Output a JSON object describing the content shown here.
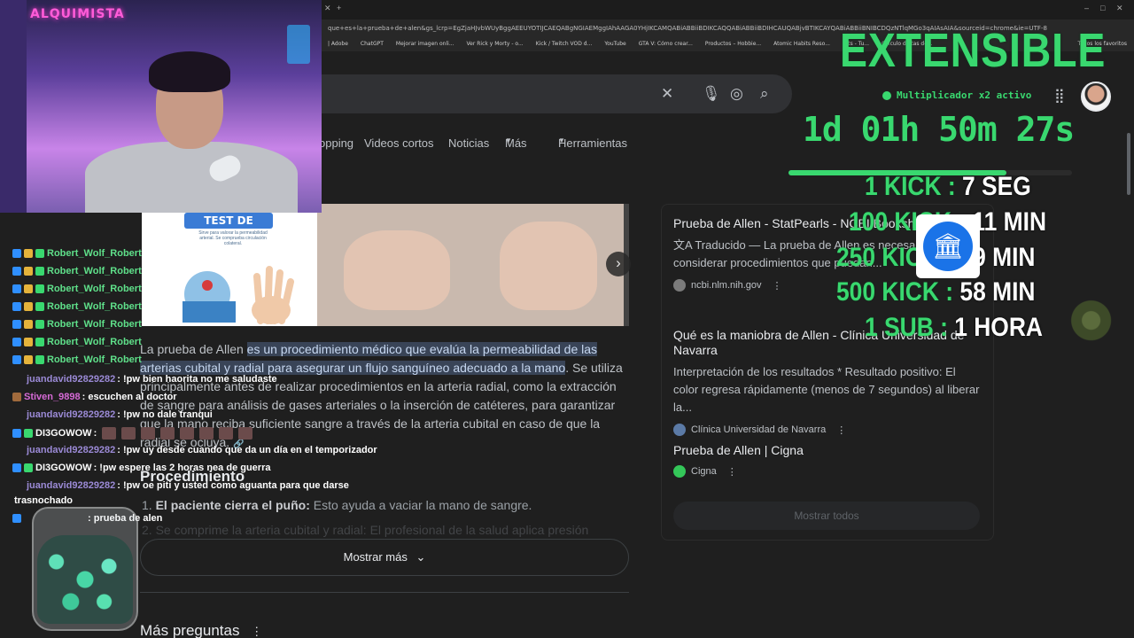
{
  "browser": {
    "url": "que+es+la+prueba+de+alen&gs_lcrp=EgZjaHJvbWUyBggAEEUYOTIJCAEQABgNGIAEMggIAhAAGA0YHjIKCAMQABiABBiiBDIKCAQQABiABBiiBDIHCAUQABjvBTIKCAYQABiABBiiBNIBCDQzNTlqMGo3qAIAsAIA&sourceid=chrome&ie=UTF-8",
    "bookmarks": [
      "| Adobe",
      "ChatGPT",
      "Mejorar imagen onli...",
      "Ver Rick y Morty - o...",
      "Kick / Twitch VOD d...",
      "YouTube",
      "GTA V: Cómo crear...",
      "Productos – Hobbie...",
      "Atomic Habits Reso...",
      "Fiits - Tu...",
      "Cálculo de tas de...",
      "Todos los favoritos"
    ]
  },
  "search": {
    "tabs": [
      "opping",
      "Videos cortos",
      "Noticias",
      "Más",
      "Herramientas"
    ]
  },
  "images": {
    "test_card_title": "TEST DE ALLEN",
    "test_card_subtitle": "Sirve para valorar la permeabilidad arterial. Se comprueba circulación colateral."
  },
  "snippet": {
    "prefix": "La prueba de Allen ",
    "highlight": "es un procedimiento médico que evalúa la permeabilidad de las arterias cubital y radial para asegurar un flujo sanguíneo adecuado a la mano",
    "rest": ". Se utiliza principalmente antes de realizar procedimientos en la arteria radial, como la extracción de sangre para análisis de gases arteriales o la inserción de catéteres, para garantizar que la mano reciba suficiente sangre a través de la arteria cubital en caso de que la radial se ocluya.",
    "procedure_title": "Procedimiento",
    "step1_bold": "El paciente cierra el puño:",
    "step1_text": " Esto ayuda a vaciar la mano de sangre.",
    "step2_text": "Se comprime la arteria cubital y radial: El profesional de la salud aplica presión",
    "show_more": "Mostrar más",
    "more_questions": "Más preguntas"
  },
  "results": [
    {
      "title": "Prueba de Allen - StatPearls - NCBI Bookshelf",
      "desc": "Traducido — La prueba de Allen es necesaria al considerar procedimientos que puedan...",
      "source": "ncbi.nlm.nih.gov"
    },
    {
      "title": "Qué es la maniobra de Allen - Clínica Universidad de Navarra",
      "desc": "Interpretación de los resultados * Resultado positivo: El color regresa rápidamente (menos de 7 segundos) al liberar la...",
      "source": "Clínica Universidad de Navarra"
    },
    {
      "title": "Prueba de Allen | Cigna",
      "desc": "",
      "source": "Cigna"
    }
  ],
  "show_all": "Mostrar todos",
  "chat": [
    {
      "user": "Robert_Wolf_Robert",
      "msg": "",
      "color": "#5fe08a"
    },
    {
      "user": "Robert_Wolf_Robert",
      "msg": "",
      "color": "#5fe08a"
    },
    {
      "user": "Robert_Wolf_Robert",
      "msg": "",
      "color": "#5fe08a"
    },
    {
      "user": "Robert_Wolf_Robert",
      "msg": "",
      "color": "#5fe08a"
    },
    {
      "user": "Robert_Wolf_Robert",
      "msg": "",
      "color": "#5fe08a"
    },
    {
      "user": "Robert_Wolf_Robert",
      "msg": "",
      "color": "#5fe08a"
    },
    {
      "user": "Robert_Wolf_Robert",
      "msg": "",
      "color": "#5fe08a"
    },
    {
      "user": "juandavid92829282",
      "msg": ": !pw bien haorita no me saludaste",
      "color": "#9b8ad6"
    },
    {
      "user": "Stiven_9898",
      "msg": ": escuchen al doctor",
      "color": "#d66ad6"
    },
    {
      "user": "juandavid92829282",
      "msg": ": !pw no dale tranqui",
      "color": "#9b8ad6"
    },
    {
      "user": "DI3GOWOW",
      "msg": ":",
      "color": "#ffffff"
    },
    {
      "user": "juandavid92829282",
      "msg": ": !pw uy desde cuando que da un día en el temporizador",
      "color": "#9b8ad6"
    },
    {
      "user": "DI3GOWOW",
      "msg": ": !pw espere las 2 horas nea de guerra",
      "color": "#ffffff"
    },
    {
      "user": "juandavid92829282",
      "msg": ": !pw oe piti y usted como aguanta para que darse",
      "color": "#9b8ad6"
    },
    {
      "user": "",
      "msg": "trasnochado",
      "color": "#ffffff"
    },
    {
      "user": "",
      "msg": ": prueba de alen",
      "color": "#e89a3c"
    }
  ],
  "overlay": {
    "title": "EXTENSIBLE",
    "multiplier": "Multiplicador x2 activo",
    "timer": "1d 01h 50m 27s",
    "progress": 0.77,
    "rates": [
      {
        "k": "1 KICK : ",
        "v": "7 SEG"
      },
      {
        "k": "100 KICK : ",
        "v": "11 MIN"
      },
      {
        "k": "250 KICK : ",
        "v": "29 MIN"
      },
      {
        "k": "500 KICK : ",
        "v": "58 MIN"
      },
      {
        "k": "1 SUB : ",
        "v": "1 HORA"
      }
    ]
  },
  "webcam": {
    "neon_sign": "ALQUIMISTA"
  },
  "colors": {
    "accent_green": "#39d86f",
    "google_bg": "#1f1f1f",
    "highlight": "#394457"
  }
}
